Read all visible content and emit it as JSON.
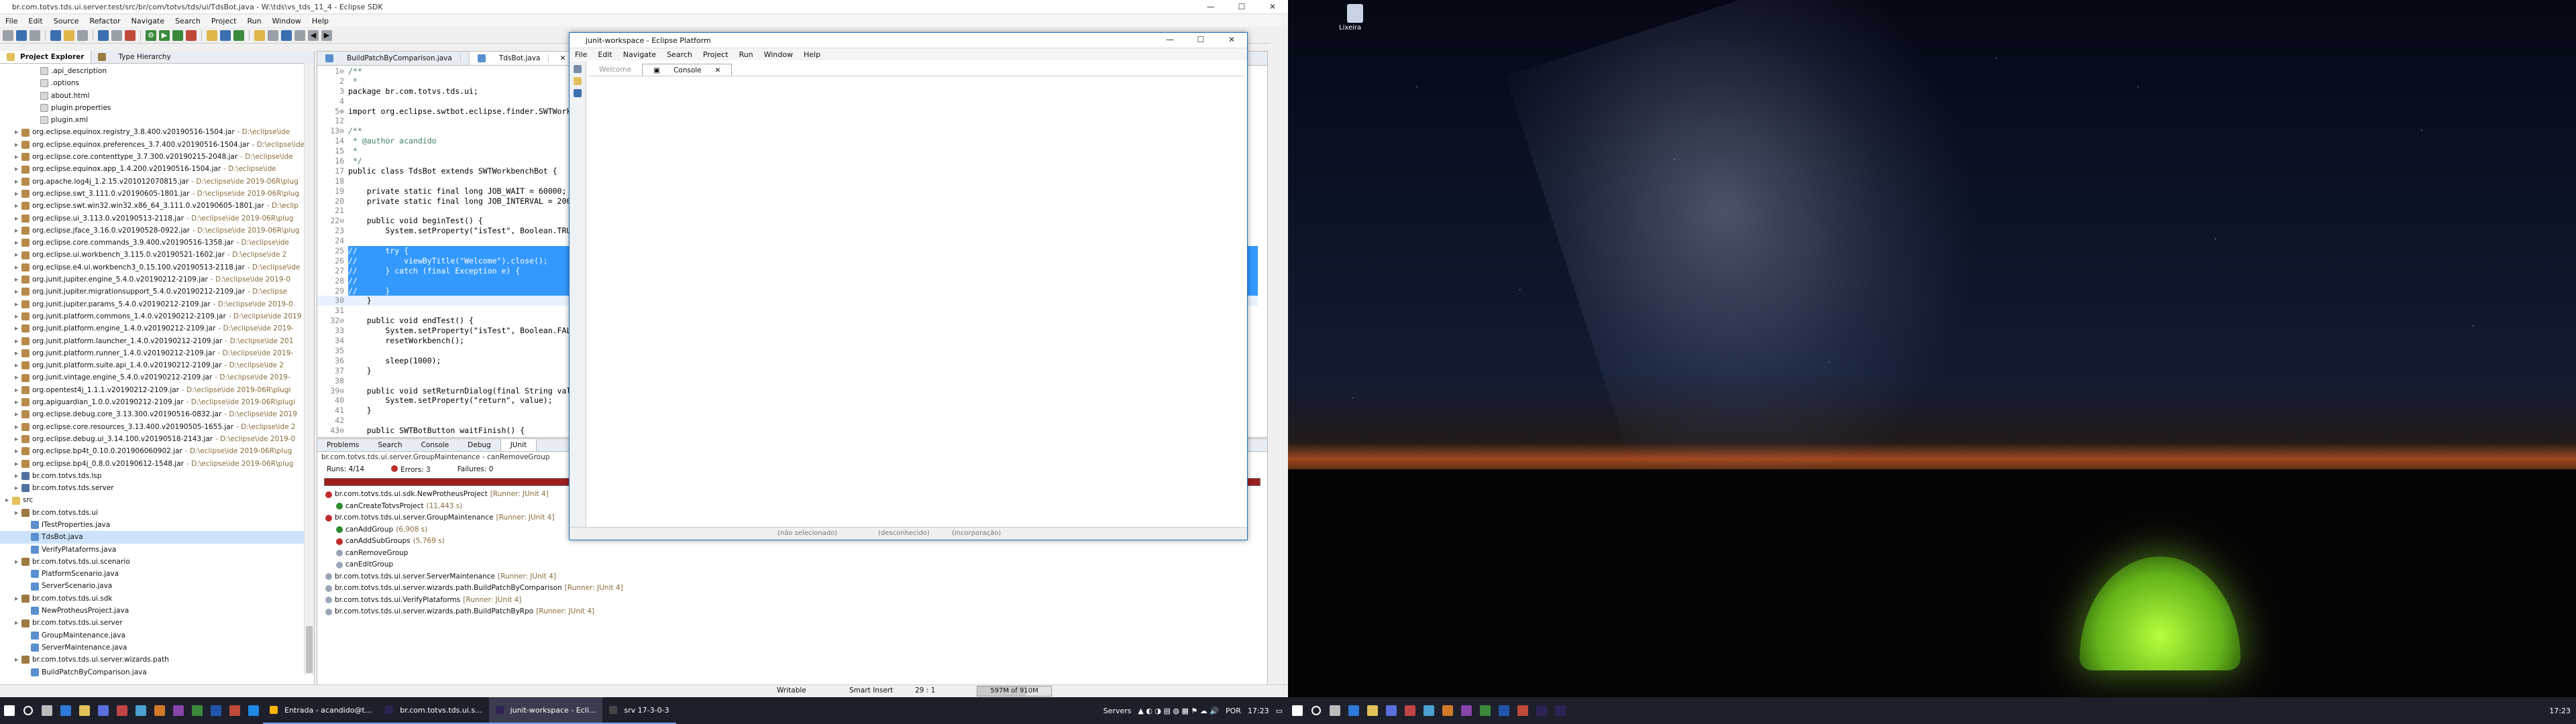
{
  "main_window": {
    "title": "br.com.totvs.tds.ui.server.test/src/br/com/totvs/tds/ui/TdsBot.java - W:\\tds\\vs_tds_11_4 - Eclipse SDK",
    "menu": [
      "File",
      "Edit",
      "Source",
      "Refactor",
      "Navigate",
      "Search",
      "Project",
      "Run",
      "Window",
      "Help"
    ]
  },
  "explorer": {
    "tab_project": "Project Explorer",
    "tab_type": "Type Hierarchy",
    "rows": [
      {
        "indent": 3,
        "icon": "file",
        "label": ".api_description",
        "path": ""
      },
      {
        "indent": 3,
        "icon": "file",
        "label": ".options",
        "path": ""
      },
      {
        "indent": 3,
        "icon": "file",
        "label": "about.html",
        "path": ""
      },
      {
        "indent": 3,
        "icon": "file",
        "label": "plugin.properties",
        "path": ""
      },
      {
        "indent": 3,
        "icon": "file",
        "label": "plugin.xml",
        "path": ""
      },
      {
        "indent": 1,
        "icon": "jar",
        "label": "org.eclipse.equinox.registry_3.8.400.v20190516-1504.jar",
        "path": "- D:\\eclipse\\ide"
      },
      {
        "indent": 1,
        "icon": "jar",
        "label": "org.eclipse.equinox.preferences_3.7.400.v20190516-1504.jar",
        "path": "- D:\\eclipse\\ide"
      },
      {
        "indent": 1,
        "icon": "jar",
        "label": "org.eclipse.core.contenttype_3.7.300.v20190215-2048.jar",
        "path": "- D:\\eclipse\\ide"
      },
      {
        "indent": 1,
        "icon": "jar",
        "label": "org.eclipse.equinox.app_1.4.200.v20190516-1504.jar",
        "path": "- D:\\eclipse\\ide"
      },
      {
        "indent": 1,
        "icon": "jar",
        "label": "org.apache.log4j_1.2.15.v201012070815.jar",
        "path": "- D:\\eclipse\\ide 2019-06R\\plug"
      },
      {
        "indent": 1,
        "icon": "jar",
        "label": "org.eclipse.swt_3.111.0.v20190605-1801.jar",
        "path": "- D:\\eclipse\\ide 2019-06R\\plug"
      },
      {
        "indent": 1,
        "icon": "jar",
        "label": "org.eclipse.swt.win32.win32.x86_64_3.111.0.v20190605-1801.jar",
        "path": "- D:\\eclip"
      },
      {
        "indent": 1,
        "icon": "jar",
        "label": "org.eclipse.ui_3.113.0.v20190513-2118.jar",
        "path": "- D:\\eclipse\\ide 2019-06R\\plug"
      },
      {
        "indent": 1,
        "icon": "jar",
        "label": "org.eclipse.jface_3.16.0.v20190528-0922.jar",
        "path": "- D:\\eclipse\\ide 2019-06R\\plug"
      },
      {
        "indent": 1,
        "icon": "jar",
        "label": "org.eclipse.core.commands_3.9.400.v20190516-1358.jar",
        "path": "- D:\\eclipse\\ide"
      },
      {
        "indent": 1,
        "icon": "jar",
        "label": "org.eclipse.ui.workbench_3.115.0.v20190521-1602.jar",
        "path": "- D:\\eclipse\\ide 2"
      },
      {
        "indent": 1,
        "icon": "jar",
        "label": "org.eclipse.e4.ui.workbench3_0.15.100.v20190513-2118.jar",
        "path": "- D:\\eclipse\\ide"
      },
      {
        "indent": 1,
        "icon": "jar",
        "label": "org.junit.jupiter.engine_5.4.0.v20190212-2109.jar",
        "path": "- D:\\eclipse\\ide 2019-0"
      },
      {
        "indent": 1,
        "icon": "jar",
        "label": "org.junit.jupiter.migrationsupport_5.4.0.v20190212-2109.jar",
        "path": "- D:\\eclipse"
      },
      {
        "indent": 1,
        "icon": "jar",
        "label": "org.junit.jupiter.params_5.4.0.v20190212-2109.jar",
        "path": "- D:\\eclipse\\ide 2019-0"
      },
      {
        "indent": 1,
        "icon": "jar",
        "label": "org.junit.platform.commons_1.4.0.v20190212-2109.jar",
        "path": "- D:\\eclipse\\ide 2019"
      },
      {
        "indent": 1,
        "icon": "jar",
        "label": "org.junit.platform.engine_1.4.0.v20190212-2109.jar",
        "path": "- D:\\eclipse\\ide 2019-"
      },
      {
        "indent": 1,
        "icon": "jar",
        "label": "org.junit.platform.launcher_1.4.0.v20190212-2109.jar",
        "path": "- D:\\eclipse\\ide 201"
      },
      {
        "indent": 1,
        "icon": "jar",
        "label": "org.junit.platform.runner_1.4.0.v20190212-2109.jar",
        "path": "- D:\\eclipse\\ide 2019-"
      },
      {
        "indent": 1,
        "icon": "jar",
        "label": "org.junit.platform.suite.api_1.4.0.v20190212-2109.jar",
        "path": "- D:\\eclipse\\ide 2"
      },
      {
        "indent": 1,
        "icon": "jar",
        "label": "org.junit.vintage.engine_5.4.0.v20190212-2109.jar",
        "path": "- D:\\eclipse\\ide 2019-"
      },
      {
        "indent": 1,
        "icon": "jar",
        "label": "org.opentest4j_1.1.1.v20190212-2109.jar",
        "path": "- D:\\eclipse\\ide 2019-06R\\plugi"
      },
      {
        "indent": 1,
        "icon": "jar",
        "label": "org.apiguardian_1.0.0.v20190212-2109.jar",
        "path": "- D:\\eclipse\\ide 2019-06R\\plugi"
      },
      {
        "indent": 1,
        "icon": "jar",
        "label": "org.eclipse.debug.core_3.13.300.v20190516-0832.jar",
        "path": "- D:\\eclipse\\ide 2019"
      },
      {
        "indent": 1,
        "icon": "jar",
        "label": "org.eclipse.core.resources_3.13.400.v20190505-1655.jar",
        "path": "- D:\\eclipse\\ide 2"
      },
      {
        "indent": 1,
        "icon": "jar",
        "label": "org.eclipse.debug.ui_3.14.100.v20190518-2143.jar",
        "path": "- D:\\eclipse\\ide 2019-0"
      },
      {
        "indent": 1,
        "icon": "jar",
        "label": "org.eclipse.bp4t_0.10.0.201906060902.jar",
        "path": "- D:\\eclipse\\ide 2019-06R\\plug"
      },
      {
        "indent": 1,
        "icon": "jar",
        "label": "org.eclipse.bp4j_0.8.0.v20190612-1548.jar",
        "path": "- D:\\eclipse\\ide 2019-06R\\plug"
      },
      {
        "indent": 1,
        "icon": "proj",
        "label": "br.com.totvs.tds.lsp",
        "path": ""
      },
      {
        "indent": 1,
        "icon": "proj",
        "label": "br.com.totvs.tds.server",
        "path": ""
      },
      {
        "indent": 0,
        "icon": "fold",
        "label": "src",
        "path": ""
      },
      {
        "indent": 1,
        "icon": "pkg",
        "label": "br.com.totvs.tds.ui",
        "path": ""
      },
      {
        "indent": 2,
        "icon": "java",
        "label": "ITestProperties.java",
        "path": ""
      },
      {
        "indent": 2,
        "icon": "java",
        "label": "TdsBot.java",
        "path": "",
        "selected": true
      },
      {
        "indent": 2,
        "icon": "java",
        "label": "VerifyPlataforms.java",
        "path": ""
      },
      {
        "indent": 1,
        "icon": "pkg",
        "label": "br.com.totvs.tds.ui.scenario",
        "path": ""
      },
      {
        "indent": 2,
        "icon": "java",
        "label": "PlatformScenario.java",
        "path": ""
      },
      {
        "indent": 2,
        "icon": "java",
        "label": "ServerScenario.java",
        "path": ""
      },
      {
        "indent": 1,
        "icon": "pkg",
        "label": "br.com.totvs.tds.ui.sdk",
        "path": ""
      },
      {
        "indent": 2,
        "icon": "java",
        "label": "NewProtheusProject.java",
        "path": ""
      },
      {
        "indent": 1,
        "icon": "pkg",
        "label": "br.com.totvs.tds.ui.server",
        "path": ""
      },
      {
        "indent": 2,
        "icon": "java",
        "label": "GroupMaintenance.java",
        "path": ""
      },
      {
        "indent": 2,
        "icon": "java",
        "label": "ServerMaintenance.java",
        "path": ""
      },
      {
        "indent": 1,
        "icon": "pkg",
        "label": "br.com.totvs.tds.ui.server.wizards.path",
        "path": ""
      },
      {
        "indent": 2,
        "icon": "java",
        "label": "BuildPatchByComparison.java",
        "path": ""
      }
    ]
  },
  "editor": {
    "tabs": [
      "BuildPatchByComparison.java",
      "TdsBot.java"
    ],
    "active_tab": 1,
    "lines": [
      {
        "n": "1⊖",
        "t": "/**",
        "cls": "cm"
      },
      {
        "n": "2",
        "t": " *",
        "cls": "cm"
      },
      {
        "n": "3",
        "t": "package br.com.totvs.tds.ui;",
        "cls": "kwl"
      },
      {
        "n": "4",
        "t": "",
        "cls": ""
      },
      {
        "n": "5⊕",
        "t": "import org.eclipse.swtbot.eclipse.finder.SWTWorkbenchBot;",
        "cls": "kwl"
      },
      {
        "n": "12",
        "t": "",
        "cls": ""
      },
      {
        "n": "13⊖",
        "t": "/**",
        "cls": "cm"
      },
      {
        "n": "14",
        "t": " * @author acandido",
        "cls": "cm"
      },
      {
        "n": "15",
        "t": " *",
        "cls": "cm"
      },
      {
        "n": "16",
        "t": " */",
        "cls": "cm"
      },
      {
        "n": "17",
        "t": "public class TdsBot extends SWTWorkbenchBot {",
        "cls": "kwl"
      },
      {
        "n": "18",
        "t": "",
        "cls": ""
      },
      {
        "n": "19",
        "t": "    private static final long JOB_WAIT = 60000;",
        "cls": "kwl"
      },
      {
        "n": "20",
        "t": "    private static final long JOB_INTERVAL = 2000;",
        "cls": "kwl"
      },
      {
        "n": "21",
        "t": "",
        "cls": ""
      },
      {
        "n": "22⊖",
        "t": "    public void beginTest() {",
        "cls": "kwl"
      },
      {
        "n": "23",
        "t": "        System.setProperty(\"isTest\", Boolean.TRUE.toString());",
        "cls": ""
      },
      {
        "n": "24",
        "t": "",
        "cls": ""
      },
      {
        "n": "25",
        "t": "//      try {",
        "cls": "hl"
      },
      {
        "n": "26",
        "t": "//          viewByTitle(\"Welcome\").close();",
        "cls": "hl"
      },
      {
        "n": "27",
        "t": "//      } catch (final Exception e) {",
        "cls": "hl"
      },
      {
        "n": "28",
        "t": "//          ",
        "cls": "hl"
      },
      {
        "n": "29",
        "t": "//      }",
        "cls": "hl"
      },
      {
        "n": "30",
        "t": "    }",
        "cls": "cur"
      },
      {
        "n": "31",
        "t": "",
        "cls": ""
      },
      {
        "n": "32⊖",
        "t": "    public void endTest() {",
        "cls": "kwl"
      },
      {
        "n": "33",
        "t": "        System.setProperty(\"isTest\", Boolean.FALSE.toString());",
        "cls": ""
      },
      {
        "n": "34",
        "t": "        resetWorkbench();",
        "cls": ""
      },
      {
        "n": "35",
        "t": "",
        "cls": ""
      },
      {
        "n": "36",
        "t": "        sleep(1000);",
        "cls": ""
      },
      {
        "n": "37",
        "t": "    }",
        "cls": ""
      },
      {
        "n": "38",
        "t": "",
        "cls": ""
      },
      {
        "n": "39⊖",
        "t": "    public void setReturnDialog(final String value) {",
        "cls": "kwl"
      },
      {
        "n": "40",
        "t": "        System.setProperty(\"return\", value);",
        "cls": ""
      },
      {
        "n": "41",
        "t": "    }",
        "cls": ""
      },
      {
        "n": "42",
        "t": "",
        "cls": ""
      },
      {
        "n": "43⊖",
        "t": "    public SWTBotButton waitFinish() {",
        "cls": "kwl"
      }
    ]
  },
  "junit": {
    "tabs": [
      "Problems",
      "Search",
      "Console",
      "Debug",
      "JUnit"
    ],
    "active_tab": 4,
    "context": "br.com.totvs.tds.ui.server.GroupMaintenance - canRemoveGroup",
    "runs_label": "Runs:",
    "runs_value": "4/14",
    "errors_label": "Errors:",
    "errors_value": "3",
    "failures_label": "Failures:",
    "failures_value": "0",
    "progress": 0.29,
    "tree": [
      {
        "indent": 0,
        "st": "err",
        "label": "br.com.totvs.tds.ui.sdk.NewProtheusProject",
        "runner": "[Runner: JUnit 4]"
      },
      {
        "indent": 1,
        "st": "ok",
        "label": "canCreateTotvsProject",
        "runner": "(11,443 s)"
      },
      {
        "indent": 0,
        "st": "err",
        "label": "br.com.totvs.tds.ui.server.GroupMaintenance",
        "runner": "[Runner: JUnit 4]"
      },
      {
        "indent": 1,
        "st": "ok",
        "label": "canAddGroup",
        "runner": "(6,908 s)"
      },
      {
        "indent": 1,
        "st": "err",
        "label": "canAddSubGroups",
        "runner": "(5,769 s)"
      },
      {
        "indent": 1,
        "st": "none",
        "label": "canRemoveGroup",
        "runner": ""
      },
      {
        "indent": 1,
        "st": "none",
        "label": "canEditGroup",
        "runner": ""
      },
      {
        "indent": 0,
        "st": "none",
        "label": "br.com.totvs.tds.ui.server.ServerMaintenance",
        "runner": "[Runner: JUnit 4]"
      },
      {
        "indent": 0,
        "st": "none",
        "label": "br.com.totvs.tds.ui.server.wizards.path.BuildPatchByComparison",
        "runner": "[Runner: JUnit 4]"
      },
      {
        "indent": 0,
        "st": "none",
        "label": "br.com.totvs.tds.ui.VerifyPlataforms",
        "runner": "[Runner: JUnit 4]"
      },
      {
        "indent": 0,
        "st": "none",
        "label": "br.com.totvs.tds.ui.server.wizards.path.BuildPatchByRpo",
        "runner": "[Runner: JUnit 4]"
      }
    ]
  },
  "statusbar": {
    "writable": "Writable",
    "insert": "Smart Insert",
    "position": "29 : 1",
    "heap": "597M of 910M",
    "heap_fraction": 0.66
  },
  "float_window": {
    "title": "junit-workspace - Eclipse Platform",
    "menu": [
      "File",
      "Edit",
      "Navigate",
      "Search",
      "Project",
      "Run",
      "Window",
      "Help"
    ],
    "tab_welcome": "Welcome",
    "tab_console": "Console",
    "status_1": "(não selecionado)",
    "status_2": "(desconhecido)",
    "status_3": "(incorporação)"
  },
  "taskbar": {
    "app1": "Entrada - acandido@t...",
    "app2": "br.com.totvs.tds.ui.s...",
    "app3": "junit-workspace - Ecli...",
    "app4": "srv 17-3-0-3",
    "tray_servers": "Servers",
    "lang": "POR",
    "time": "17:23",
    "time2": "17:23"
  },
  "desktop": {
    "recycle_label": "Lixeira"
  }
}
